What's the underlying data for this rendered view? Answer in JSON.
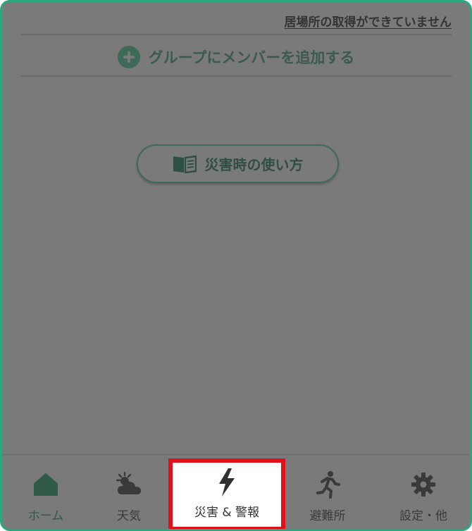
{
  "header": {
    "location_status": "居場所の取得ができていません"
  },
  "group": {
    "add_member_label": "グループにメンバーを追加する"
  },
  "guide": {
    "howto_label": "災害時の使い方"
  },
  "tabbar": {
    "items": [
      {
        "label": "ホーム",
        "icon": "home-icon"
      },
      {
        "label": "天気",
        "icon": "weather-icon"
      },
      {
        "label": "災害 & 警報",
        "icon": "lightning-icon"
      },
      {
        "label": "避難所",
        "icon": "running-person-icon"
      },
      {
        "label": "設定・他",
        "icon": "gear-icon"
      }
    ],
    "selected": "災害 & 警報"
  },
  "colors": {
    "overlay": "#7a7a7a",
    "frame_border": "#2aa77f",
    "accent_green": "#3e6a58",
    "highlight_red": "#e0101b"
  }
}
